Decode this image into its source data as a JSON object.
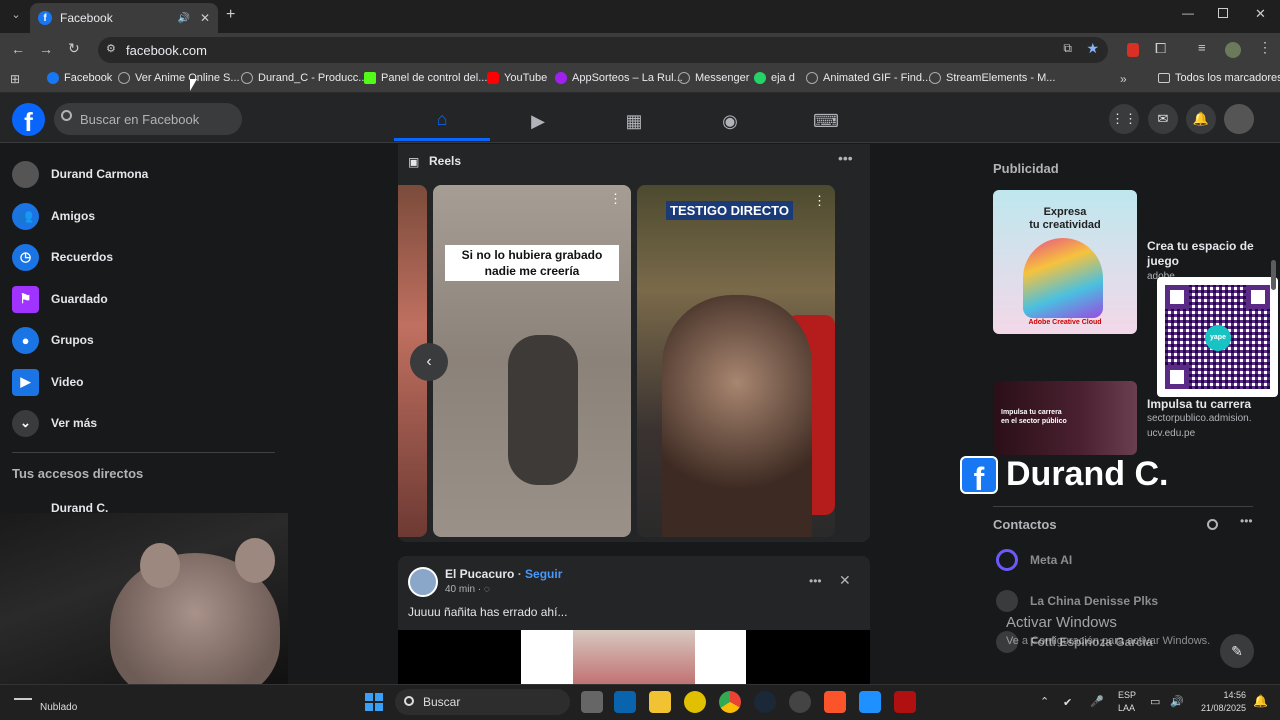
{
  "browser": {
    "tab_title": "Facebook",
    "url": "facebook.com",
    "bookmarks": [
      {
        "label": "Facebook",
        "color": "#1877f2"
      },
      {
        "label": "Ver Anime Online S...",
        "color": "#888888"
      },
      {
        "label": "Durand_C - Producc...",
        "color": "#888888"
      },
      {
        "label": "Panel de control del...",
        "color": "#53fc18"
      },
      {
        "label": "YouTube",
        "color": "#ff0000"
      },
      {
        "label": "AppSorteos – La Rul...",
        "color": "#a020f0"
      },
      {
        "label": "Messenger",
        "color": "#888888"
      },
      {
        "label": "eja d",
        "color": "#25d366"
      },
      {
        "label": "Animated GIF - Find...",
        "color": "#888888"
      },
      {
        "label": "StreamElements - M...",
        "color": "#888888"
      }
    ],
    "all_bookmarks": "Todos los marcadores"
  },
  "fb": {
    "search_placeholder": "Buscar en Facebook",
    "sidebar": [
      {
        "label": "Durand Carmona",
        "icon": "avatar",
        "color": "#555555"
      },
      {
        "label": "Amigos",
        "icon": "friends-icon",
        "color": "#1b74e4"
      },
      {
        "label": "Recuerdos",
        "icon": "clock-icon",
        "color": "#1b74e4"
      },
      {
        "label": "Guardado",
        "icon": "bookmark-icon",
        "color": "#a033ff"
      },
      {
        "label": "Grupos",
        "icon": "groups-icon",
        "color": "#1b74e4"
      },
      {
        "label": "Video",
        "icon": "video-icon",
        "color": "#1b74e4"
      },
      {
        "label": "Ver más",
        "icon": "chevron-down-icon",
        "color": "#3a3b3c"
      }
    ],
    "shortcuts_title": "Tus accesos directos",
    "shortcut_first": "Durand C.",
    "reels_title": "Reels",
    "reel1_caption": "Si no lo hubiera grabado nadie me creería",
    "reel2_caption": "TESTIGO DIRECTO",
    "post": {
      "author": "El Pucacuro",
      "follow": "Seguir",
      "time": "40 min",
      "text": "Juuuu ñañita has errado ahí..."
    },
    "ads_title": "Publicidad",
    "ad1": {
      "image_line1": "Expresa",
      "image_line2": "tu creatividad",
      "brand": "Adobe Creative Cloud",
      "title": "Crea tu espacio de juego",
      "domain": "adobe"
    },
    "ad2": {
      "image_line1": "Impulsa tu carrera",
      "image_line2": "en el sector público",
      "title": "Impulsa tu carrera",
      "domain1": "sectorpublico.admision.",
      "domain2": "ucv.edu.pe"
    },
    "overlay_name": "Durand C.",
    "contacts_title": "Contactos",
    "contacts": [
      {
        "name": "Meta AI"
      },
      {
        "name": "La China Denisse Plks"
      },
      {
        "name": "Fotti Espinoza Garcia"
      }
    ],
    "qr_label": "yape"
  },
  "windows": {
    "activate_title": "Activar Windows",
    "activate_sub": "Ve a Configuración para activar Windows.",
    "weather": "Nublado",
    "search": "Buscar",
    "lang1": "ESP",
    "lang2": "LAA",
    "time": "14:56",
    "date": "21/08/2025"
  }
}
